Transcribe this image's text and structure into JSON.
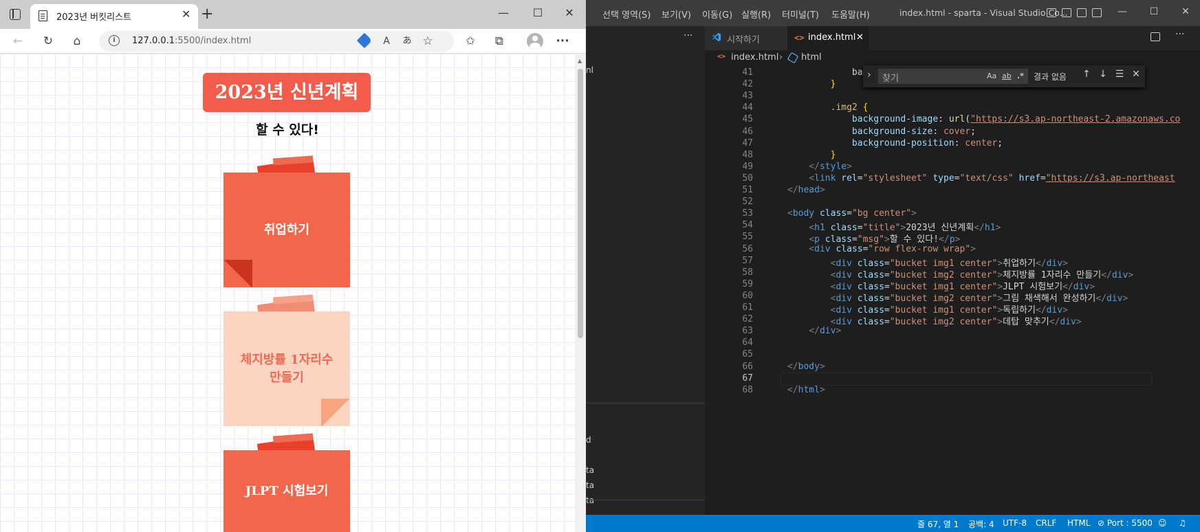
{
  "browser": {
    "tab_title": "2023년 버킷리스트",
    "address_host": "127.0.0.1",
    "address_rest": ":5500/index.html",
    "page": {
      "title": "2023년 신년계획",
      "message": "할 수 있다!",
      "buckets": [
        {
          "text": "취업하기",
          "style": "red"
        },
        {
          "text": "체지방률 1자리수\n만들기",
          "style": "peach"
        },
        {
          "text": "JLPT 시험보기",
          "style": "red"
        }
      ]
    }
  },
  "vscode": {
    "menus": [
      "선택 영역(S)",
      "보기(V)",
      "이동(G)",
      "실행(R)",
      "터미널(T)",
      "도움말(H)"
    ],
    "window_title": "index.html - sparta - Visual Studio Co...",
    "tabs": [
      {
        "label": "시작하기",
        "active": false
      },
      {
        "label": "index.html",
        "active": true
      }
    ],
    "breadcrumb": {
      "file": "index.html",
      "node": "html"
    },
    "sidebar_fragments": [
      "nl",
      "d",
      "ta",
      "ta",
      "ta"
    ],
    "find": {
      "placeholder": "찾기",
      "result": "결과 없음",
      "opt_case": "Aa",
      "opt_word": "ab",
      "opt_regex": ".*"
    },
    "code": [
      {
        "n": "41",
        "t": "            back"
      },
      {
        "n": "42",
        "t": "        }"
      },
      {
        "n": "43",
        "t": ""
      },
      {
        "n": "44",
        "t": "        .img2 {"
      },
      {
        "n": "45",
        "t": "            background-image: url(\"https://s3.ap-northeast-2.amazonaws.co"
      },
      {
        "n": "46",
        "t": "            background-size: cover;"
      },
      {
        "n": "47",
        "t": "            background-position: center;"
      },
      {
        "n": "48",
        "t": "        }"
      },
      {
        "n": "49",
        "t": "    </style>"
      },
      {
        "n": "50",
        "t": "    <link rel=\"stylesheet\" type=\"text/css\" href=\"https://s3.ap-northeast"
      },
      {
        "n": "51",
        "t": "</head>"
      },
      {
        "n": "52",
        "t": ""
      },
      {
        "n": "53",
        "t": "<body class=\"bg center\">"
      },
      {
        "n": "54",
        "t": "    <h1 class=\"title\">2023년 신년계획</h1>"
      },
      {
        "n": "55",
        "t": "    <p class=\"msg\">할 수 있다!</p>"
      },
      {
        "n": "56",
        "t": "    <div class=\"row flex-row wrap\">"
      },
      {
        "n": "57",
        "t": "        <div class=\"bucket img1 center\">취업하기</div>"
      },
      {
        "n": "58",
        "t": "        <div class=\"bucket img2 center\">체지방률 1자리수 만들기</div>"
      },
      {
        "n": "59",
        "t": "        <div class=\"bucket img1 center\">JLPT 시험보기</div>"
      },
      {
        "n": "60",
        "t": "        <div class=\"bucket img2 center\">그림 채색해서 완성하기</div>"
      },
      {
        "n": "61",
        "t": "        <div class=\"bucket img1 center\">독립하기</div>"
      },
      {
        "n": "62",
        "t": "        <div class=\"bucket img2 center\">데탑 맞추기</div>"
      },
      {
        "n": "63",
        "t": "    </div>"
      },
      {
        "n": "64",
        "t": ""
      },
      {
        "n": "65",
        "t": ""
      },
      {
        "n": "66",
        "t": "</body>"
      },
      {
        "n": "67",
        "t": ""
      },
      {
        "n": "68",
        "t": "</html>"
      }
    ],
    "current_line": "67",
    "status": {
      "position": "줄 67, 열 1",
      "spaces": "공백: 4",
      "encoding": "UTF-8",
      "eol": "CRLF",
      "language": "HTML",
      "port": "Port : 5500"
    }
  },
  "colors": {
    "title_bg": "#f35b4a",
    "note_red": "#f2674b",
    "note_peach": "#fbd4c2",
    "vscode_status": "#007acc"
  }
}
